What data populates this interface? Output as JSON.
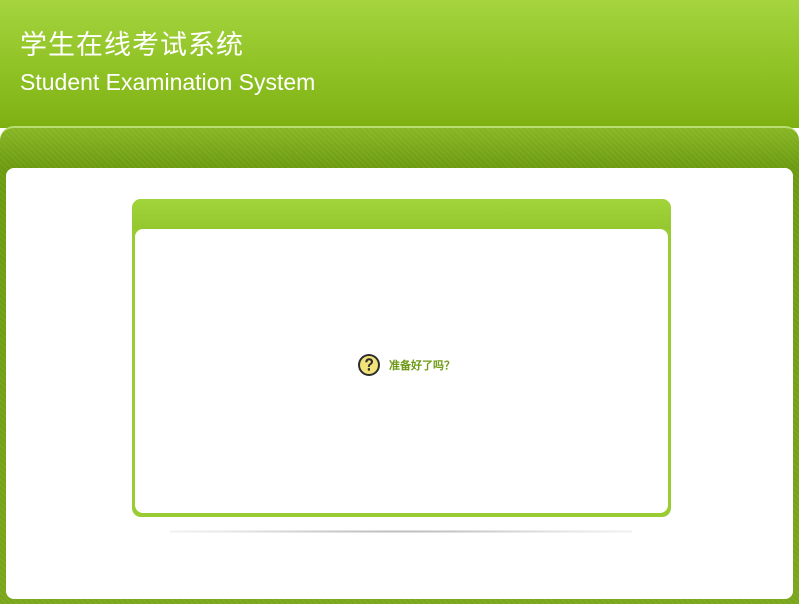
{
  "header": {
    "title": "学生在线考试系统",
    "subtitle": "Student Examination System"
  },
  "prompt": {
    "icon": "question-icon",
    "text": "准备好了吗？"
  },
  "colors": {
    "header_green": "#8fc225",
    "frame_green": "#6c9a10",
    "card_green": "#99cc33",
    "prompt_text": "#6f9a16",
    "icon_fill": "#f2e27a"
  }
}
